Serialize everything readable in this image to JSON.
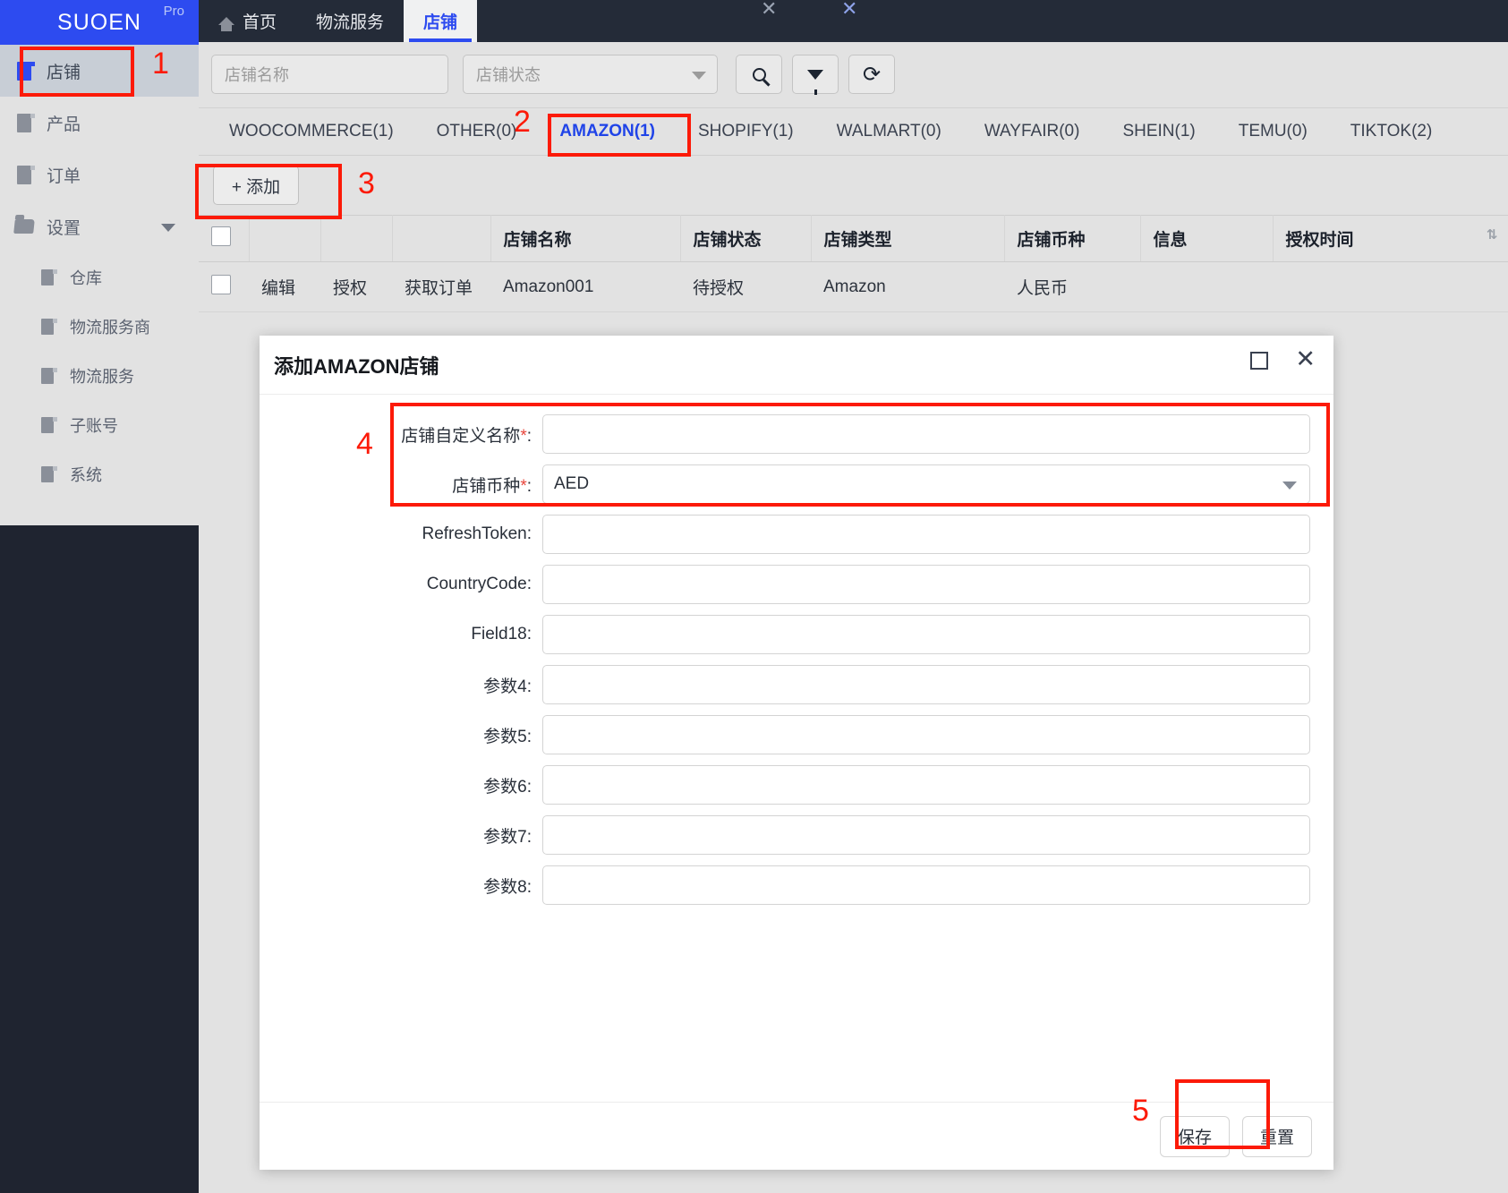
{
  "brand": {
    "name": "SUOEN",
    "pro": "Pro"
  },
  "sidebar": {
    "items": [
      {
        "label": "店铺",
        "icon": "document-icon",
        "active": true
      },
      {
        "label": "产品",
        "icon": "document-icon",
        "active": false
      },
      {
        "label": "订单",
        "icon": "document-icon",
        "active": false
      },
      {
        "label": "设置",
        "icon": "folder-icon",
        "active": false,
        "expandable": true
      }
    ],
    "sub_items": [
      {
        "label": "仓库",
        "icon": "document-icon"
      },
      {
        "label": "物流服务商",
        "icon": "document-icon"
      },
      {
        "label": "物流服务",
        "icon": "document-icon"
      },
      {
        "label": "子账号",
        "icon": "document-icon"
      },
      {
        "label": "系统",
        "icon": "document-icon"
      }
    ]
  },
  "topbar": {
    "tabs": [
      {
        "label": "首页",
        "icon": "home-icon",
        "current": false,
        "closable": false
      },
      {
        "label": "物流服务",
        "icon": "",
        "current": false,
        "closable": true
      },
      {
        "label": "店铺",
        "icon": "",
        "current": true,
        "closable": true
      }
    ],
    "close_glyph": "✕"
  },
  "filterbar": {
    "shop_name_placeholder": "店铺名称",
    "shop_status_placeholder": "店铺状态",
    "buttons": [
      {
        "name": "search-button",
        "icon": "search-icon"
      },
      {
        "name": "filter-button",
        "icon": "funnel-icon"
      },
      {
        "name": "refresh-button",
        "icon": "refresh-icon",
        "glyph": "⟳"
      }
    ]
  },
  "platform_tabs": [
    {
      "label": "WOOCOMMERCE(1)",
      "selected": false
    },
    {
      "label": "OTHER(0)",
      "selected": false
    },
    {
      "label": "AMAZON(1)",
      "selected": true
    },
    {
      "label": "SHOPIFY(1)",
      "selected": false
    },
    {
      "label": "WALMART(0)",
      "selected": false
    },
    {
      "label": "WAYFAIR(0)",
      "selected": false
    },
    {
      "label": "SHEIN(1)",
      "selected": false
    },
    {
      "label": "TEMU(0)",
      "selected": false
    },
    {
      "label": "TIKTOK(2)",
      "selected": false
    }
  ],
  "toolbar": {
    "add_label": "+  添加"
  },
  "table": {
    "headers": [
      "",
      "",
      "",
      "",
      "店铺名称",
      "店铺状态",
      "店铺类型",
      "店铺币种",
      "信息",
      "授权时间"
    ],
    "sort_glyph": "⇅",
    "rows": [
      {
        "actions": [
          "编辑",
          "授权",
          "获取订单"
        ],
        "shop_name": "Amazon001",
        "shop_status": "待授权",
        "shop_type": "Amazon",
        "currency": "人民币",
        "info": "",
        "auth_time": ""
      }
    ]
  },
  "modal": {
    "title": "添加AMAZON店铺",
    "maximize_icon": "maximize-icon",
    "close_glyph": "✕",
    "fields": [
      {
        "label": "店铺自定义名称",
        "required": true,
        "type": "text",
        "value": ""
      },
      {
        "label": "店铺币种",
        "required": true,
        "type": "select",
        "value": "AED"
      },
      {
        "label": "RefreshToken",
        "required": false,
        "type": "text",
        "value": ""
      },
      {
        "label": "CountryCode",
        "required": false,
        "type": "text",
        "value": ""
      },
      {
        "label": "Field18",
        "required": false,
        "type": "text",
        "value": ""
      },
      {
        "label": "参数4",
        "required": false,
        "type": "text",
        "value": ""
      },
      {
        "label": "参数5",
        "required": false,
        "type": "text",
        "value": ""
      },
      {
        "label": "参数6",
        "required": false,
        "type": "text",
        "value": ""
      },
      {
        "label": "参数7",
        "required": false,
        "type": "text",
        "value": ""
      },
      {
        "label": "参数8",
        "required": false,
        "type": "text",
        "value": ""
      }
    ],
    "save_label": "保存",
    "reset_label": "重置"
  },
  "annotations": {
    "color": "#fc1a08",
    "markers": [
      {
        "number": "1",
        "target": "sidebar-item-shop"
      },
      {
        "number": "2",
        "target": "platform-tab-amazon"
      },
      {
        "number": "3",
        "target": "add-button"
      },
      {
        "number": "4",
        "target": "required-fields-group"
      },
      {
        "number": "5",
        "target": "save-button"
      }
    ]
  }
}
